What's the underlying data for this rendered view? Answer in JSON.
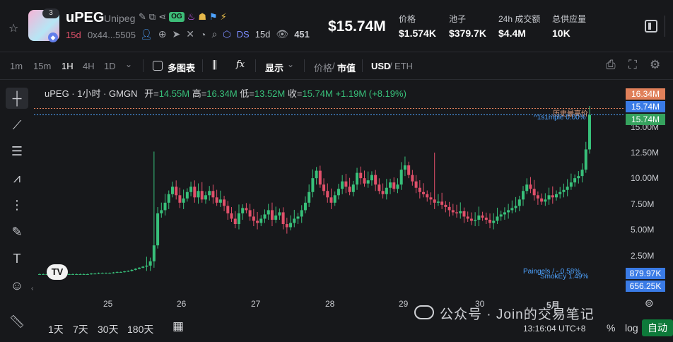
{
  "header": {
    "token_symbol": "uPEG",
    "token_name": "Unipeg",
    "avatar_badge": "3",
    "og_badge": "OG",
    "age": "15d",
    "address": "0x44...5505",
    "ds_label": "DS",
    "ds_age": "15d",
    "views": "451",
    "market_cap": "$15.74M",
    "stats": [
      {
        "label": "价格",
        "value": "$1.574K"
      },
      {
        "label": "池子",
        "value": "$379.7K"
      },
      {
        "label": "24h 成交额",
        "value": "$4.4M"
      },
      {
        "label": "总供应量",
        "value": "10K"
      }
    ]
  },
  "toolbar": {
    "intervals": [
      "1m",
      "15m",
      "1H",
      "4H",
      "1D"
    ],
    "active_interval": "1H",
    "multi_chart": "多图表",
    "display": "显示",
    "price_label": "价格",
    "sep": "/",
    "mcap_label": "市值",
    "usd_label": "USD",
    "eth_label": "ETH",
    "fx": "fx"
  },
  "legend": {
    "title": "uPEG · 1小时 · GMGN",
    "open_label": "开=",
    "open": "14.55M",
    "high_label": "高=",
    "high": "16.34M",
    "low_label": "低=",
    "low": "13.52M",
    "close_label": "收=",
    "close": "15.74M",
    "change": "+1.19M (+8.19%)"
  },
  "price_tags": {
    "high": "16.34M",
    "last1": "15.74M",
    "last2": "15.74M",
    "vol1": "879.97K",
    "vol2": "656.25K"
  },
  "annotations": {
    "ath": "历史最高价",
    "sniper": "^1s1mple 0.00%",
    "paingels": "Paingels / - 0.58%",
    "smokey": "SmokEy 1.49%"
  },
  "bottom": {
    "ranges": [
      "1天",
      "7天",
      "30天",
      "180天"
    ],
    "time": "13:16:04 UTC+8",
    "percent": "%",
    "log": "log",
    "auto": "自动",
    "watermark": "公众号 · Join的交易笔记"
  },
  "chart_data": {
    "type": "candlestick",
    "title": "uPEG · 1小时 · GMGN",
    "x_ticks": [
      "25",
      "26",
      "27",
      "28",
      "29",
      "30",
      "5月"
    ],
    "y_ticks": [
      "2.50M",
      "5.00M",
      "7.50M",
      "10.00M",
      "12.50M",
      "15.00M"
    ],
    "ylim": [
      0,
      17.5
    ],
    "unit": "M",
    "series": [
      {
        "name": "uPEG",
        "values": [
          0.8,
          0.8,
          0.8,
          0.8,
          0.8,
          0.8,
          0.8,
          0.8,
          0.8,
          0.8,
          0.8,
          0.8,
          0.8,
          0.8,
          0.85,
          0.85,
          0.9,
          0.9,
          0.9,
          0.9,
          0.95,
          1.0,
          1.0,
          1.05,
          1.1,
          1.2,
          1.3,
          1.4,
          1.5,
          1.6,
          2.0,
          3.5,
          6.5,
          6.8,
          7.5,
          8.3,
          9.0,
          8.2,
          7.5,
          7.9,
          8.5,
          9.0,
          8.0,
          8.6,
          7.8,
          8.2,
          8.6,
          8.0,
          7.5,
          7.8,
          7.2,
          6.5,
          6.0,
          5.5,
          6.5,
          7.0,
          6.8,
          6.2,
          5.8,
          5.6,
          6.0,
          6.4,
          6.8,
          5.9,
          6.3,
          6.6,
          5.5,
          5.2,
          5.6,
          6.0,
          6.2,
          6.8,
          7.5,
          8.5,
          9.8,
          10.5,
          9.2,
          8.6,
          8.0,
          7.5,
          8.2,
          8.8,
          9.5,
          9.0,
          8.5,
          9.2,
          10.3,
          9.8,
          9.3,
          9.6,
          10.1,
          9.2,
          8.6,
          8.3,
          8.9,
          9.4,
          8.8,
          9.2,
          10.6,
          11.0,
          10.1,
          9.5,
          8.9,
          8.5,
          8.3,
          8.0,
          7.8,
          7.5,
          7.6,
          7.3,
          7.1,
          6.8,
          6.6,
          6.5,
          6.7,
          6.2,
          6.0,
          5.8,
          5.9,
          6.3,
          6.1,
          5.9,
          5.6,
          5.8,
          6.2,
          6.4,
          6.6,
          6.8,
          7.0,
          7.2,
          7.8,
          8.6,
          9.2,
          8.8,
          8.2,
          7.9,
          7.6,
          7.8,
          8.2,
          8.0,
          8.3,
          8.5,
          8.7,
          9.0,
          9.4,
          9.8,
          10.0,
          10.6,
          12.5,
          15.74
        ]
      }
    ]
  }
}
